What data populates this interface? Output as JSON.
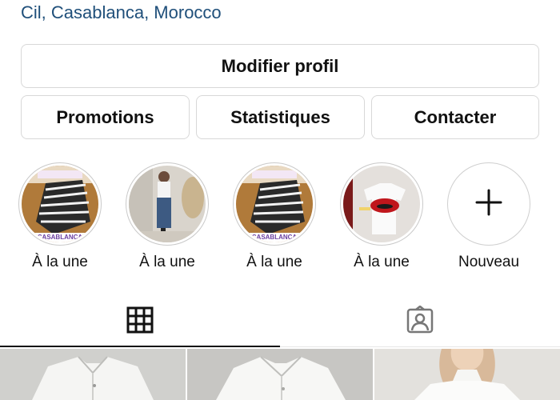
{
  "profile": {
    "location": "Cil, Casablanca, Morocco"
  },
  "buttons": {
    "edit_profile": "Modifier profil",
    "promotions": "Promotions",
    "statistics": "Statistiques",
    "contact": "Contacter"
  },
  "highlights": [
    {
      "label": "À la une",
      "thumb_text": "CASABLANCA"
    },
    {
      "label": "À la une"
    },
    {
      "label": "À la une",
      "thumb_text": "CASABLANCA"
    },
    {
      "label": "À la une"
    },
    {
      "label": "Nouveau",
      "icon": "plus-icon"
    }
  ],
  "tabs": [
    {
      "name": "grid",
      "icon": "grid-icon",
      "active": true
    },
    {
      "name": "tagged",
      "icon": "tagged-person-icon",
      "active": false
    }
  ],
  "posts": [
    {
      "subject": "white shirt"
    },
    {
      "subject": "white shirt"
    },
    {
      "subject": "white top"
    }
  ]
}
